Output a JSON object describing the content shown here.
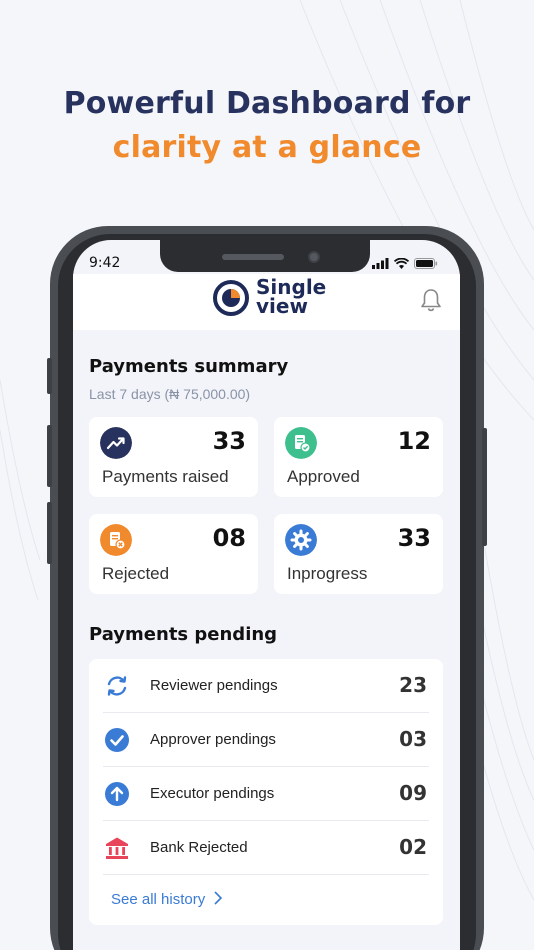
{
  "headline": {
    "line1": "Powerful Dashboard for",
    "line2": "clarity at a glance"
  },
  "status_bar": {
    "time": "9:42",
    "icons": [
      "signal-icon",
      "wifi-icon",
      "battery-icon"
    ]
  },
  "app": {
    "logo_line1": "Single",
    "logo_line2": "view",
    "bell_icon": "bell-icon"
  },
  "summary": {
    "title": "Payments summary",
    "subtitle": "Last 7 days (₦ 75,000.00)",
    "cards": [
      {
        "label": "Payments raised",
        "value": "33",
        "icon": "trend-up-icon",
        "color": "#27325e"
      },
      {
        "label": "Approved",
        "value": "12",
        "icon": "document-check-icon",
        "color": "#3ebf8e"
      },
      {
        "label": "Rejected",
        "value": "08",
        "icon": "document-reject-icon",
        "color": "#f08a2c"
      },
      {
        "label": "Inprogress",
        "value": "33",
        "icon": "gear-icon",
        "color": "#3a7bd5"
      }
    ]
  },
  "pending": {
    "title": "Payments pending",
    "rows": [
      {
        "label": "Reviewer pendings",
        "value": "23",
        "icon": "refresh-icon",
        "color": "#3a7bd5"
      },
      {
        "label": "Approver pendings",
        "value": "03",
        "icon": "check-circle-icon",
        "color": "#3a7bd5"
      },
      {
        "label": "Executor pendings",
        "value": "09",
        "icon": "arrow-up-circle-icon",
        "color": "#3a7bd5"
      },
      {
        "label": "Bank Rejected",
        "value": "02",
        "icon": "bank-icon",
        "color": "#e8445a"
      }
    ],
    "see_all": "See all history"
  }
}
